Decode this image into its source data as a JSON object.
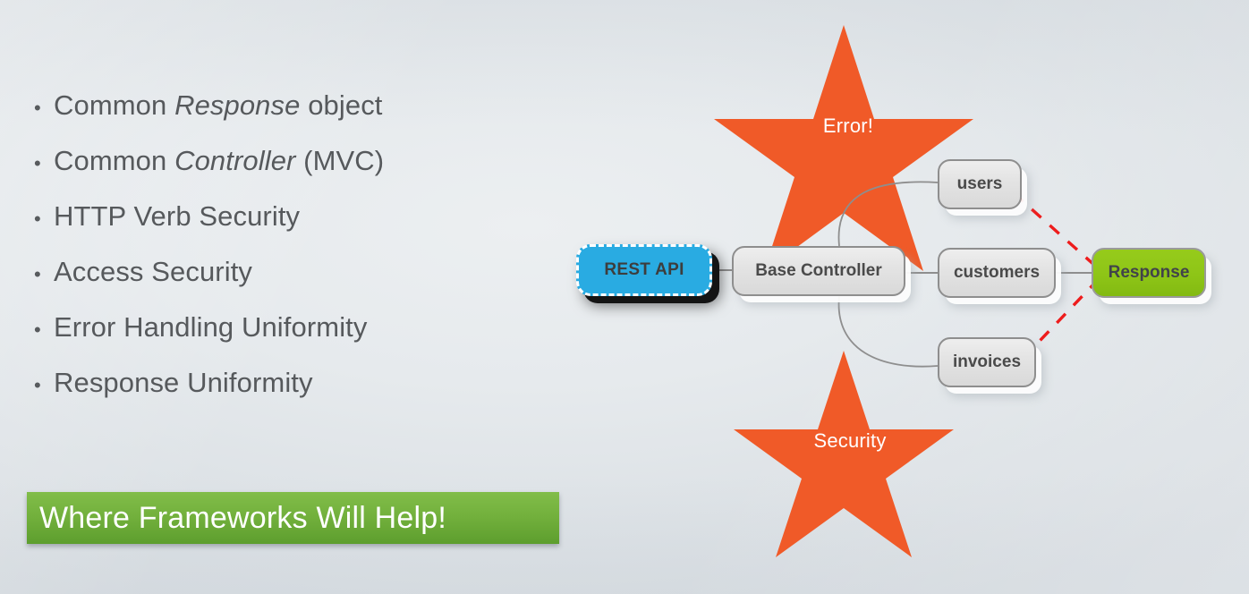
{
  "slide": {
    "background_color": "#e4e8eb"
  },
  "bullets": {
    "marker": "•",
    "items": [
      {
        "lead": "Common ",
        "emphasis": "Response",
        "trail": " object"
      },
      {
        "lead": "Common ",
        "emphasis": "Controller",
        "trail": " (MVC)"
      },
      {
        "lead": "HTTP Verb Security",
        "emphasis": "",
        "trail": ""
      },
      {
        "lead": "Access Security",
        "emphasis": "",
        "trail": ""
      },
      {
        "lead": "Error Handling Uniformity",
        "emphasis": "",
        "trail": ""
      },
      {
        "lead": "Response Uniformity",
        "emphasis": "",
        "trail": ""
      }
    ]
  },
  "banner": {
    "text": "Where Frameworks Will Help!",
    "background_color": "#72b03c",
    "text_color": "#ffffff"
  },
  "diagram": {
    "nodes": {
      "rest_api": {
        "label": "REST API",
        "color": "#29abe2"
      },
      "base_controller": {
        "label": "Base Controller",
        "color": "#e4e4e4"
      },
      "users": {
        "label": "users",
        "color": "#e4e4e4"
      },
      "customers": {
        "label": "customers",
        "color": "#e4e4e4"
      },
      "invoices": {
        "label": "invoices",
        "color": "#e4e4e4"
      },
      "response": {
        "label": "Response",
        "color": "#8ec517"
      }
    },
    "stars": [
      {
        "label": "Error!",
        "color": "#f05a28"
      },
      {
        "label": "Security",
        "color": "#f05a28"
      }
    ],
    "connector_color": "#8e8e8e",
    "dashed_connector_color": "#ee1c1c"
  }
}
